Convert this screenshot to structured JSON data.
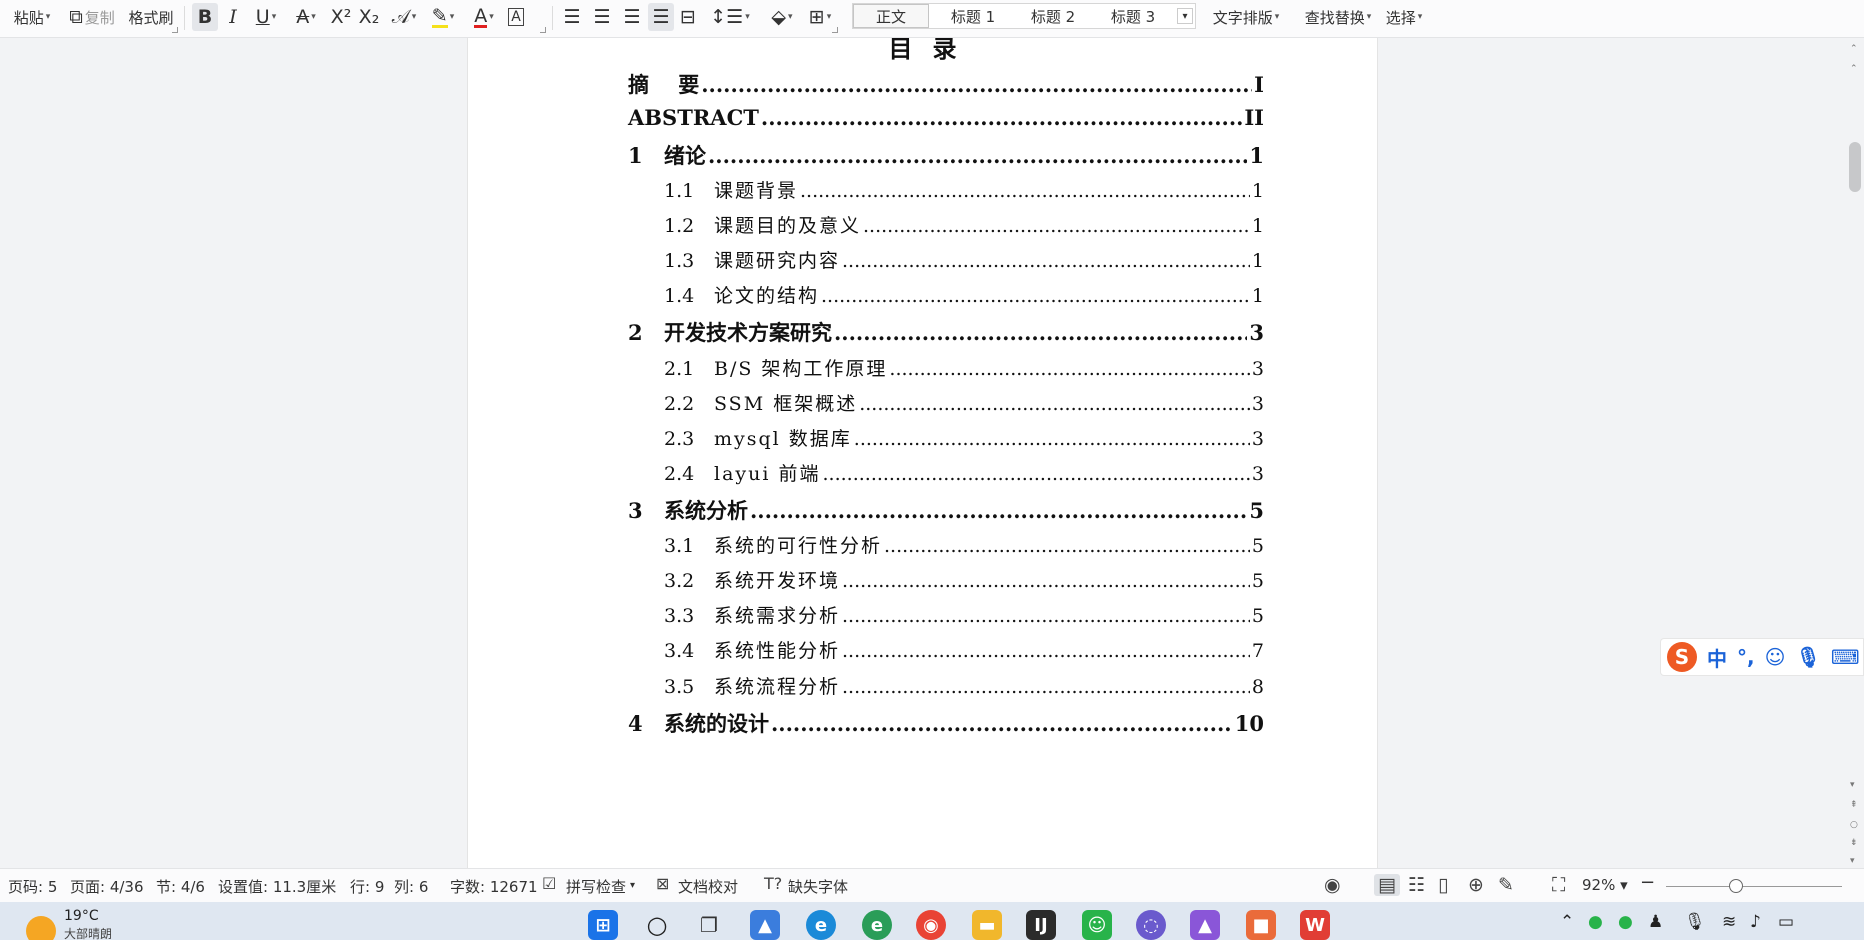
{
  "toolbar": {
    "paste": "粘贴",
    "copy": "复制",
    "format_painter": "格式刷",
    "styles": [
      "正文",
      "标题 1",
      "标题 2",
      "标题 3"
    ],
    "text_layout": "文字排版",
    "find_replace": "查找替换",
    "select": "选择"
  },
  "document": {
    "toc_title": "目录",
    "entries": [
      {
        "level": 1,
        "num": "",
        "title": "摘    要",
        "page": "I"
      },
      {
        "level": 1,
        "num": "",
        "title": "ABSTRACT",
        "page": "II"
      },
      {
        "level": 1,
        "num": "1",
        "title": "绪论",
        "page": "1"
      },
      {
        "level": 2,
        "num": "1.1",
        "title": "课题背景",
        "page": "1"
      },
      {
        "level": 2,
        "num": "1.2",
        "title": "课题目的及意义",
        "page": "1"
      },
      {
        "level": 2,
        "num": "1.3",
        "title": "课题研究内容",
        "page": "1"
      },
      {
        "level": 2,
        "num": "1.4",
        "title": "论文的结构",
        "page": "1"
      },
      {
        "level": 1,
        "num": "2",
        "title": "开发技术方案研究",
        "page": "3"
      },
      {
        "level": 2,
        "num": "2.1",
        "title": "B/S 架构工作原理",
        "page": "3"
      },
      {
        "level": 2,
        "num": "2.2",
        "title": "SSM 框架概述",
        "page": "3"
      },
      {
        "level": 2,
        "num": "2.3",
        "title": "mysql 数据库",
        "page": "3"
      },
      {
        "level": 2,
        "num": "2.4",
        "title": "layui 前端",
        "page": "3"
      },
      {
        "level": 1,
        "num": "3",
        "title": "系统分析",
        "page": "5"
      },
      {
        "level": 2,
        "num": "3.1",
        "title": "系统的可行性分析",
        "page": "5"
      },
      {
        "level": 2,
        "num": "3.2",
        "title": "系统开发环境",
        "page": "5"
      },
      {
        "level": 2,
        "num": "3.3",
        "title": "系统需求分析",
        "page": "5"
      },
      {
        "level": 2,
        "num": "3.4",
        "title": "系统性能分析",
        "page": "7"
      },
      {
        "level": 2,
        "num": "3.5",
        "title": "系统流程分析",
        "page": "8"
      },
      {
        "level": 1,
        "num": "4",
        "title": "系统的设计",
        "page": "10"
      }
    ]
  },
  "statusbar": {
    "page_code": "页码: 5",
    "page": "页面: 4/36",
    "section": "节: 4/6",
    "setting": "设置值: 11.3厘米",
    "row": "行: 9",
    "col": "列: 6",
    "word_count": "字数: 12671",
    "spell_check": "拼写检查",
    "doc_proof": "文档校对",
    "missing_font": "缺失字体",
    "zoom": "92%",
    "zoom_level": 0.4
  },
  "taskbar": {
    "temperature": "19°C",
    "weather": "大部晴朗"
  },
  "ime": {
    "mode": "中",
    "punct": "°,"
  }
}
